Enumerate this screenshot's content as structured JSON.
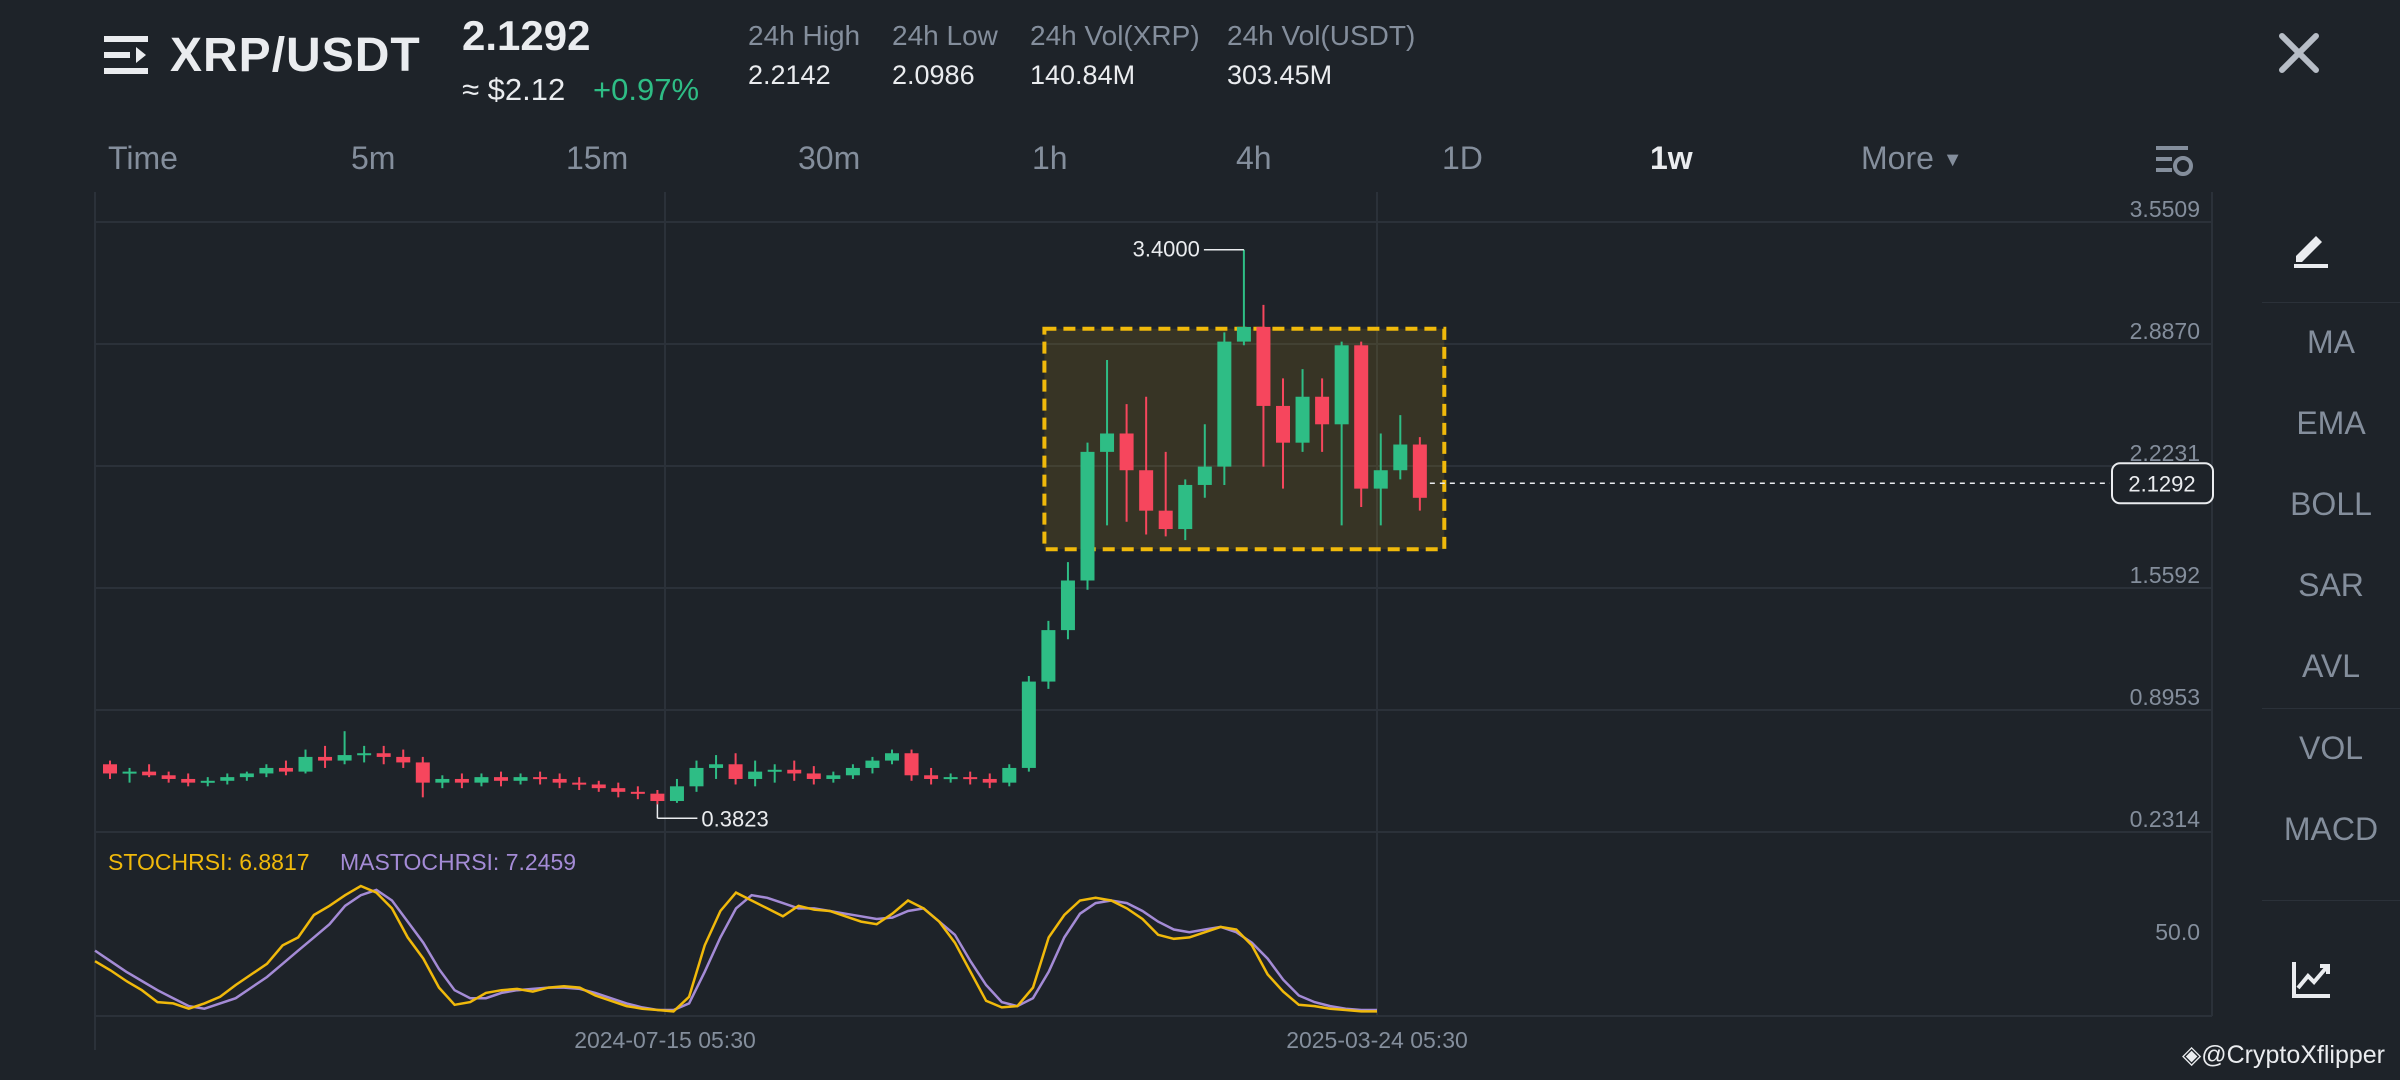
{
  "header": {
    "pair": "XRP/USDT",
    "last_price": "2.1292",
    "usd_approx": "≈ $2.12",
    "change": "+0.97%",
    "stats": [
      {
        "label": "24h High",
        "value": "2.2142"
      },
      {
        "label": "24h Low",
        "value": "2.0986"
      },
      {
        "label": "24h Vol(XRP)",
        "value": "140.84M"
      },
      {
        "label": "24h Vol(USDT)",
        "value": "303.45M"
      }
    ]
  },
  "intervals": [
    "Time",
    "5m",
    "15m",
    "30m",
    "1h",
    "4h",
    "1D",
    "1w",
    "More"
  ],
  "active_interval": "1w",
  "chart_data": {
    "type": "candlestick",
    "y_ticks": [
      "3.5509",
      "2.8870",
      "2.2231",
      "1.5592",
      "0.8953",
      "0.2314"
    ],
    "ylim": [
      0.2314,
      3.5509
    ],
    "x_labels": [
      "2024-07-15 05:30",
      "2025-03-24 05:30"
    ],
    "current_price_tag": "2.1292",
    "annotations": {
      "high": "3.4000",
      "low": "0.3823"
    },
    "highlight_box": {
      "from_index": 48,
      "to_index": 66,
      "y_top": 2.97,
      "y_bottom": 1.77
    },
    "candles": [
      [
        0.6,
        0.62,
        0.55,
        0.52
      ],
      [
        0.55,
        0.58,
        0.56,
        0.5
      ],
      [
        0.56,
        0.6,
        0.54,
        0.53
      ],
      [
        0.54,
        0.56,
        0.52,
        0.5
      ],
      [
        0.52,
        0.55,
        0.5,
        0.48
      ],
      [
        0.5,
        0.53,
        0.51,
        0.48
      ],
      [
        0.51,
        0.55,
        0.53,
        0.49
      ],
      [
        0.53,
        0.56,
        0.55,
        0.51
      ],
      [
        0.55,
        0.6,
        0.58,
        0.53
      ],
      [
        0.58,
        0.62,
        0.56,
        0.54
      ],
      [
        0.56,
        0.68,
        0.64,
        0.55
      ],
      [
        0.64,
        0.7,
        0.62,
        0.58
      ],
      [
        0.62,
        0.78,
        0.65,
        0.6
      ],
      [
        0.65,
        0.7,
        0.66,
        0.61
      ],
      [
        0.66,
        0.7,
        0.64,
        0.6
      ],
      [
        0.64,
        0.68,
        0.61,
        0.58
      ],
      [
        0.61,
        0.64,
        0.5,
        0.42
      ],
      [
        0.5,
        0.54,
        0.52,
        0.47
      ],
      [
        0.52,
        0.55,
        0.5,
        0.47
      ],
      [
        0.5,
        0.55,
        0.53,
        0.48
      ],
      [
        0.53,
        0.56,
        0.51,
        0.48
      ],
      [
        0.51,
        0.55,
        0.53,
        0.49
      ],
      [
        0.53,
        0.56,
        0.52,
        0.49
      ],
      [
        0.52,
        0.55,
        0.5,
        0.47
      ],
      [
        0.5,
        0.53,
        0.49,
        0.46
      ],
      [
        0.49,
        0.51,
        0.47,
        0.45
      ],
      [
        0.47,
        0.5,
        0.45,
        0.42
      ],
      [
        0.45,
        0.48,
        0.44,
        0.41
      ],
      [
        0.44,
        0.46,
        0.4,
        0.3823
      ],
      [
        0.4,
        0.52,
        0.48,
        0.39
      ],
      [
        0.48,
        0.62,
        0.58,
        0.45
      ],
      [
        0.58,
        0.65,
        0.6,
        0.52
      ],
      [
        0.6,
        0.66,
        0.52,
        0.49
      ],
      [
        0.52,
        0.62,
        0.56,
        0.48
      ],
      [
        0.56,
        0.6,
        0.57,
        0.5
      ],
      [
        0.57,
        0.62,
        0.55,
        0.51
      ],
      [
        0.55,
        0.59,
        0.52,
        0.49
      ],
      [
        0.52,
        0.56,
        0.54,
        0.5
      ],
      [
        0.54,
        0.6,
        0.58,
        0.52
      ],
      [
        0.58,
        0.64,
        0.62,
        0.55
      ],
      [
        0.62,
        0.68,
        0.66,
        0.6
      ],
      [
        0.66,
        0.68,
        0.54,
        0.51
      ],
      [
        0.54,
        0.58,
        0.52,
        0.49
      ],
      [
        0.52,
        0.55,
        0.53,
        0.5
      ],
      [
        0.53,
        0.56,
        0.52,
        0.49
      ],
      [
        0.52,
        0.55,
        0.5,
        0.47
      ],
      [
        0.5,
        0.6,
        0.58,
        0.48
      ],
      [
        0.58,
        1.08,
        1.05,
        0.56
      ],
      [
        1.05,
        1.38,
        1.33,
        1.01
      ],
      [
        1.33,
        1.7,
        1.6,
        1.28
      ],
      [
        1.6,
        2.35,
        2.3,
        1.55
      ],
      [
        2.3,
        2.8,
        2.4,
        1.9
      ],
      [
        2.4,
        2.56,
        2.2,
        1.92
      ],
      [
        2.2,
        2.6,
        1.98,
        1.85
      ],
      [
        1.98,
        2.3,
        1.88,
        1.84
      ],
      [
        1.88,
        2.15,
        2.12,
        1.82
      ],
      [
        2.12,
        2.45,
        2.22,
        2.05
      ],
      [
        2.22,
        2.95,
        2.9,
        2.12
      ],
      [
        2.9,
        3.4,
        2.98,
        2.88
      ],
      [
        2.98,
        3.1,
        2.55,
        2.22
      ],
      [
        2.55,
        2.7,
        2.35,
        2.1
      ],
      [
        2.35,
        2.75,
        2.6,
        2.3
      ],
      [
        2.6,
        2.7,
        2.45,
        2.3
      ],
      [
        2.45,
        2.9,
        2.88,
        1.9
      ],
      [
        2.88,
        2.9,
        2.1,
        2.0
      ],
      [
        2.1,
        2.4,
        2.2,
        1.9
      ],
      [
        2.2,
        2.5,
        2.34,
        2.15
      ],
      [
        2.34,
        2.38,
        2.05,
        1.98
      ]
    ],
    "indicator": {
      "name": "STOCHRSI",
      "labels": {
        "stoch": "STOCHRSI: 6.8817",
        "ma": "MASTOCHRSI: 7.2459"
      },
      "mid_label": "50.0",
      "stoch": [
        40,
        33,
        25,
        18,
        9,
        8,
        4,
        8,
        13,
        22,
        30,
        38,
        52,
        58,
        75,
        82,
        90,
        97,
        92,
        80,
        58,
        42,
        20,
        7,
        9,
        16,
        18,
        19,
        17,
        20,
        21,
        20,
        14,
        10,
        6,
        4,
        3,
        2,
        13,
        52,
        78,
        92,
        86,
        80,
        74,
        82,
        79,
        78,
        74,
        70,
        68,
        76,
        86,
        80,
        70,
        54,
        32,
        10,
        5,
        6,
        20,
        58,
        75,
        86,
        88,
        86,
        80,
        72,
        60,
        57,
        58,
        62,
        66,
        64,
        52,
        30,
        17,
        7,
        6,
        4,
        3,
        2,
        2
      ],
      "ma": [
        48,
        40,
        32,
        25,
        18,
        12,
        6,
        4,
        8,
        12,
        20,
        28,
        38,
        48,
        58,
        68,
        82,
        90,
        94,
        86,
        70,
        54,
        34,
        18,
        12,
        12,
        16,
        18,
        19,
        20,
        20,
        19,
        16,
        12,
        8,
        5,
        3,
        3,
        8,
        32,
        58,
        80,
        90,
        88,
        84,
        80,
        80,
        78,
        76,
        74,
        72,
        73,
        78,
        80,
        70,
        60,
        40,
        22,
        9,
        6,
        12,
        32,
        58,
        76,
        84,
        86,
        84,
        78,
        70,
        64,
        62,
        64,
        66,
        62,
        54,
        42,
        26,
        14,
        9,
        6,
        4,
        3,
        3
      ]
    }
  },
  "indicator_panel": [
    "MA",
    "EMA",
    "BOLL",
    "SAR",
    "AVL",
    "VOL",
    "MACD"
  ],
  "credit": "@CryptoXflipper",
  "colors": {
    "up": "#2ebd85",
    "down": "#f6465d",
    "stoch": "#f0b90b",
    "ma": "#a48bd6",
    "box": "#f0b90b"
  }
}
